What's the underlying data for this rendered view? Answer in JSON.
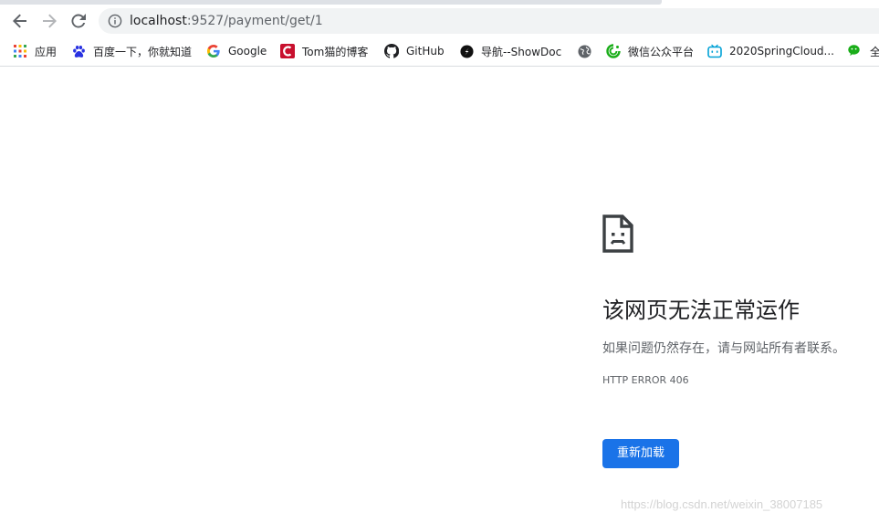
{
  "address_bar": {
    "url_host": "localhost",
    "url_rest": ":9527/payment/get/1"
  },
  "bookmarks": [
    {
      "label": "应用",
      "icon": "apps-grid-icon"
    },
    {
      "label": "百度一下，你就知道",
      "icon": "baidu-paw-icon"
    },
    {
      "label": "Google",
      "icon": "google-g-icon"
    },
    {
      "label": "Tom猫的博客",
      "icon": "tom-blog-icon"
    },
    {
      "label": "GitHub",
      "icon": "github-icon"
    },
    {
      "label": "导航--ShowDoc",
      "icon": "showdoc-icon"
    },
    {
      "label": "",
      "icon": "globe-icon"
    },
    {
      "label": "微信公众平台",
      "icon": "wechat-mp-icon"
    },
    {
      "label": "2020SpringCloud...",
      "icon": "bilibili-tv-icon"
    },
    {
      "label": "全",
      "icon": "wechat-chat-icon"
    }
  ],
  "error": {
    "icon": "sad-page-icon",
    "title": "该网页无法正常运作",
    "description": "如果问题仍然存在，请与网站所有者联系。",
    "code": "HTTP ERROR 406",
    "reload_label": "重新加载"
  },
  "watermark": "https://blog.csdn.net/weixin_38007185",
  "colors": {
    "accent_blue": "#1a73e8",
    "text_primary": "#202124",
    "text_secondary": "#5f6368",
    "omnibox_bg": "#f1f3f4"
  }
}
